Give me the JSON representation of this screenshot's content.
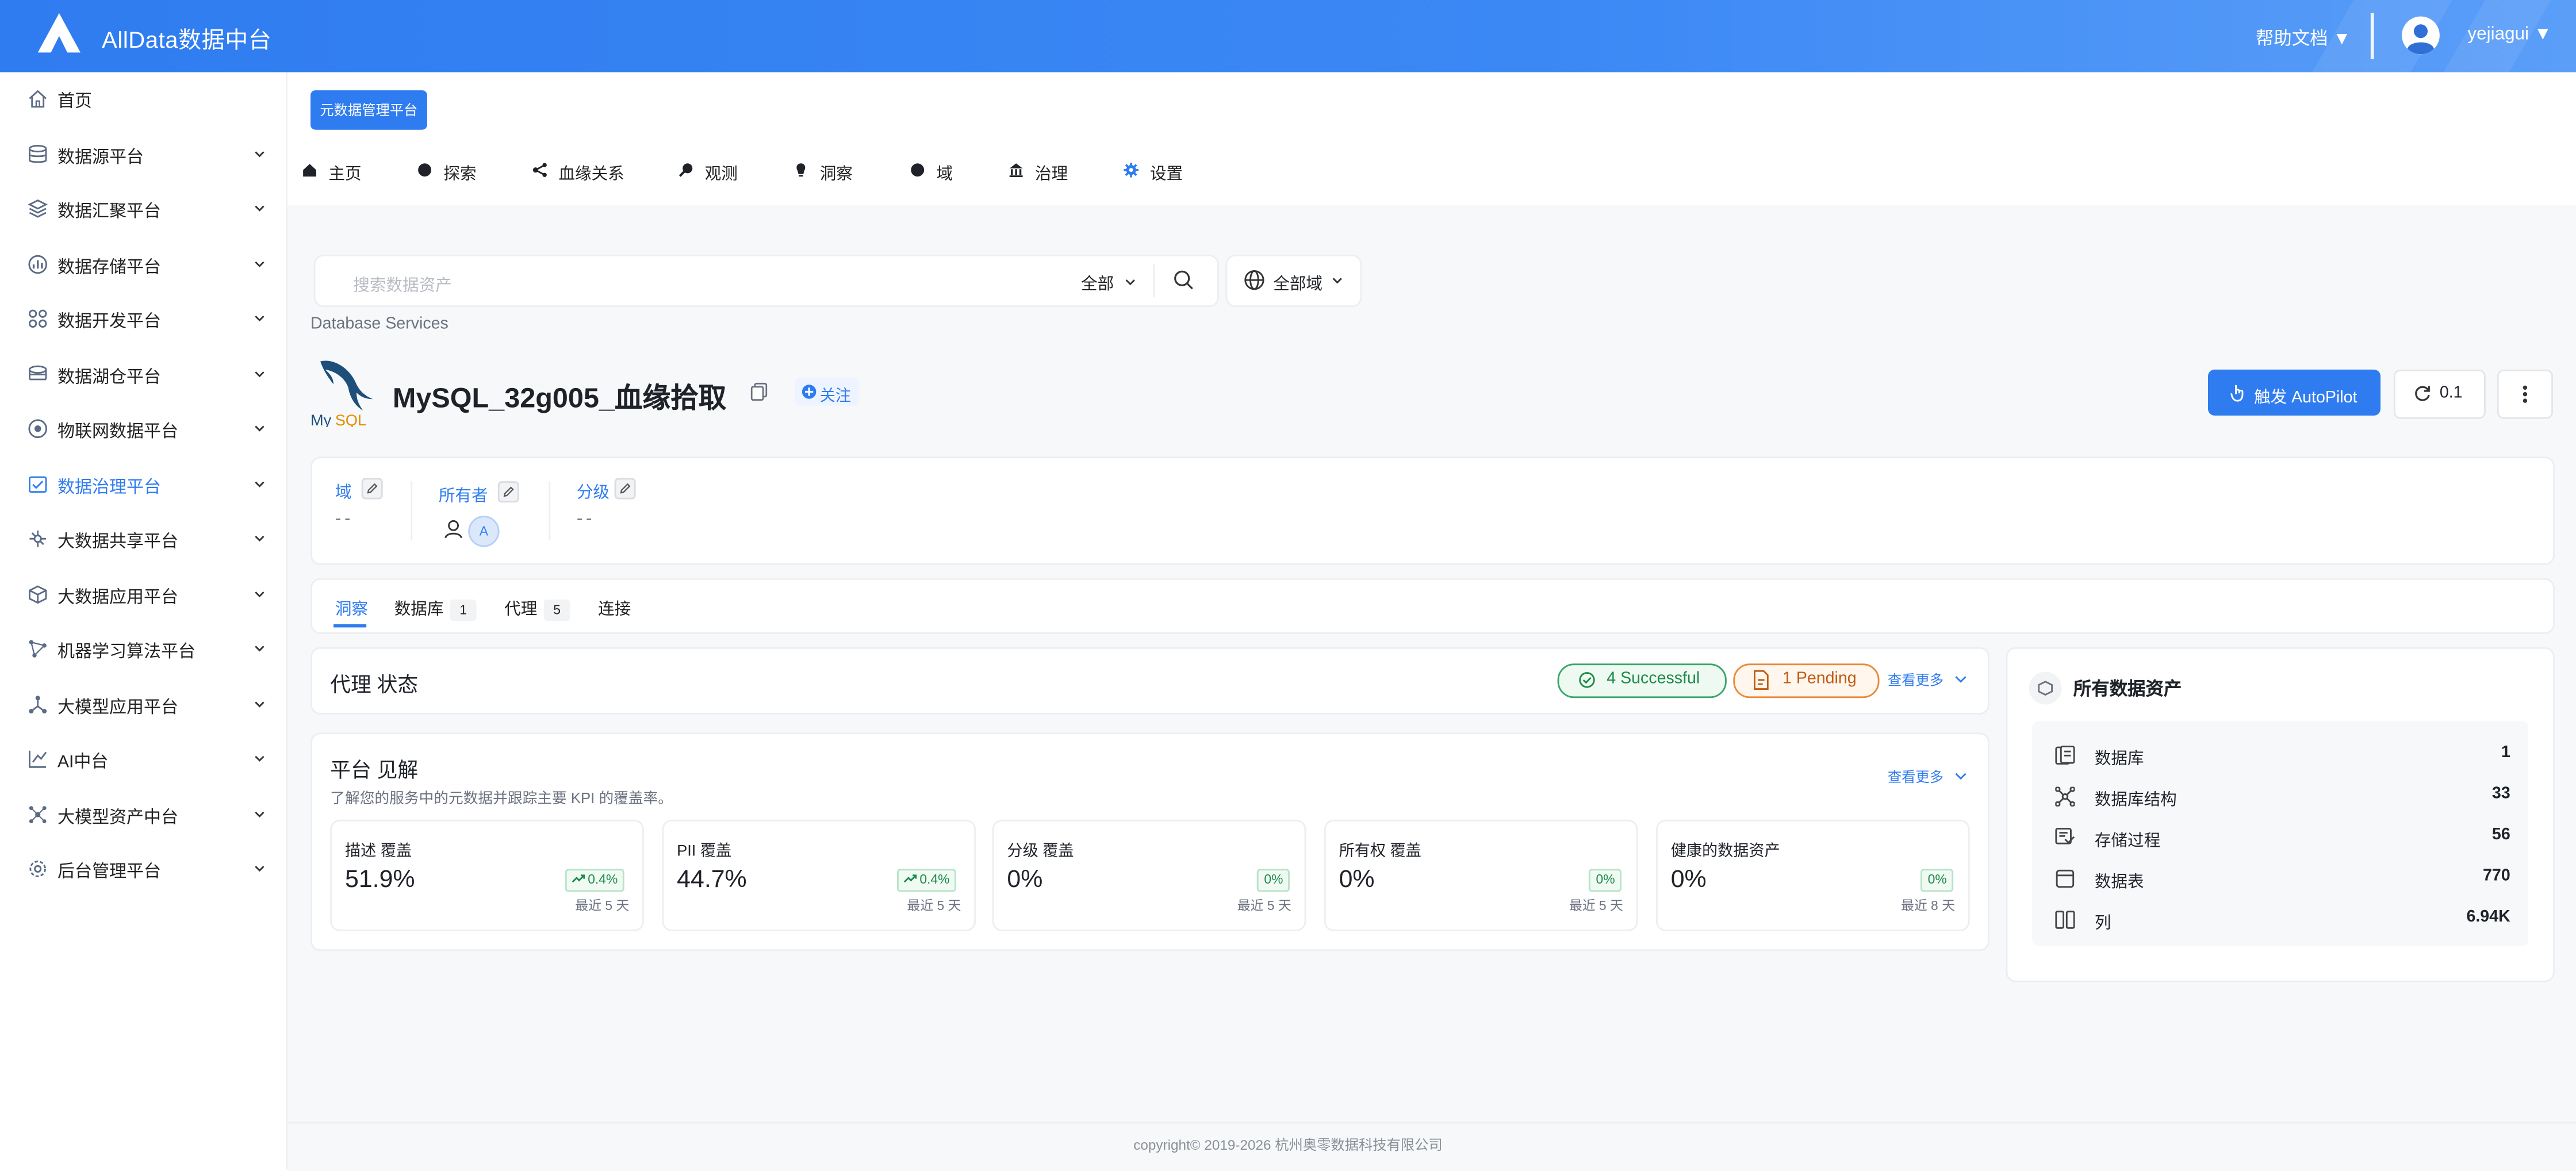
{
  "header": {
    "app_title": "AllData数据中台",
    "help_label": "帮助文档 ▼",
    "user_label": "yejiagui ▼"
  },
  "sidebar": {
    "items": [
      {
        "label": "首页",
        "icon": "home-icon"
      },
      {
        "label": "数据源平台",
        "icon": "database-icon"
      },
      {
        "label": "数据汇聚平台",
        "icon": "layers-icon"
      },
      {
        "label": "数据存储平台",
        "icon": "bar-chart-icon"
      },
      {
        "label": "数据开发平台",
        "icon": "apps-icon"
      },
      {
        "label": "数据湖仓平台",
        "icon": "lake-icon"
      },
      {
        "label": "物联网数据平台",
        "icon": "iot-icon"
      },
      {
        "label": "数据治理平台",
        "icon": "governance-icon",
        "active": true
      },
      {
        "label": "大数据共享平台",
        "icon": "share-icon"
      },
      {
        "label": "大数据应用平台",
        "icon": "cube-icon"
      },
      {
        "label": "机器学习算法平台",
        "icon": "ml-icon"
      },
      {
        "label": "大模型应用平台",
        "icon": "model-icon"
      },
      {
        "label": "AI中台",
        "icon": "ai-icon"
      },
      {
        "label": "大模型资产中台",
        "icon": "asset-icon"
      },
      {
        "label": "后台管理平台",
        "icon": "admin-icon"
      }
    ]
  },
  "toolbar": {
    "meta_button": "元数据管理平台",
    "nav": [
      "主页",
      "探索",
      "血缘关系",
      "观测",
      "洞察",
      "域",
      "治理",
      "设置"
    ]
  },
  "search": {
    "placeholder": "搜索数据资产",
    "scope": "全部",
    "domain": "全部域"
  },
  "breadcrumb": "Database Services",
  "service": {
    "title": "MySQL_32g005_血缘拾取",
    "follow_label": "关注",
    "autopilot_label": "触发 AutoPilot",
    "version": "0.1"
  },
  "info": {
    "domain_label": "域",
    "domain_value": "--",
    "owner_label": "所有者",
    "owner_avatar": "A",
    "tier_label": "分级",
    "tier_value": "--"
  },
  "tabs": [
    {
      "label": "洞察",
      "count": ""
    },
    {
      "label": "数据库",
      "count": "1"
    },
    {
      "label": "代理",
      "count": "5"
    },
    {
      "label": "连接",
      "count": ""
    }
  ],
  "agent_status": {
    "title": "代理 状态",
    "successful": "4 Successful",
    "pending": "1 Pending",
    "see_more": "查看更多"
  },
  "insights": {
    "title": "平台 见解",
    "subtitle": "了解您的服务中的元数据并跟踪主要 KPI 的覆盖率。",
    "see_more": "查看更多",
    "kpis": [
      {
        "title": "描述 覆盖",
        "value": "51.9%",
        "delta": "0.4%",
        "period": "最近 5 天"
      },
      {
        "title": "PII 覆盖",
        "value": "44.7%",
        "delta": "0.4%",
        "period": "最近 5 天"
      },
      {
        "title": "分级 覆盖",
        "value": "0%",
        "delta": "0%",
        "period": "最近 5 天"
      },
      {
        "title": "所有权 覆盖",
        "value": "0%",
        "delta": "0%",
        "period": "最近 5 天"
      },
      {
        "title": "健康的数据资产",
        "value": "0%",
        "delta": "0%",
        "period": "最近 8 天"
      }
    ]
  },
  "assets": {
    "title": "所有数据资产",
    "rows": [
      {
        "label": "数据库",
        "value": "1"
      },
      {
        "label": "数据库结构",
        "value": "33"
      },
      {
        "label": "存储过程",
        "value": "56"
      },
      {
        "label": "数据表",
        "value": "770"
      },
      {
        "label": "列",
        "value": "6.94K"
      }
    ]
  },
  "footer": "copyright© 2019-2026 杭州奥零数据科技有限公司"
}
